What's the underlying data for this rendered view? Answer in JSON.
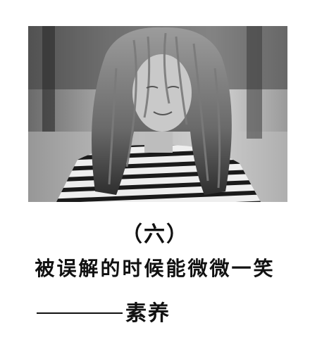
{
  "photo": {
    "style": "grayscale"
  },
  "chapter": {
    "label": "（六）"
  },
  "title": {
    "text": "被误解的时候能微微一笑"
  },
  "author": {
    "name": "素养"
  },
  "colors": {
    "text": "#111111",
    "background": "#ffffff"
  }
}
